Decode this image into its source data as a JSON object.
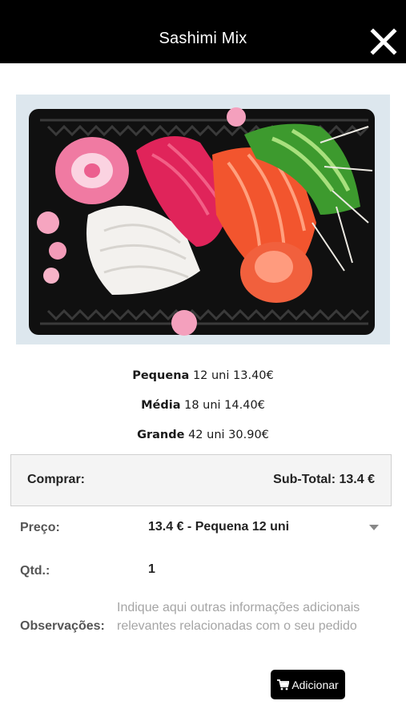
{
  "header": {
    "title": "Sashimi Mix",
    "close_icon": "close-icon"
  },
  "product_image": {
    "description_icon": "sashimi-photo"
  },
  "sizes": [
    {
      "name": "Pequena",
      "detail": "12 uni 13.40€"
    },
    {
      "name": "Média",
      "detail": "18 uni 14.40€"
    },
    {
      "name": "Grande",
      "detail": "42 uni 30.90€"
    }
  ],
  "buybar": {
    "left_label": "Comprar:",
    "subtotal": "Sub-Total: 13.4 €"
  },
  "form": {
    "price_label": "Preço:",
    "price_value": "13.4 € - Pequena 12 uni",
    "qty_label": "Qtd.:",
    "qty_value": "1",
    "obs_label": "Observações:",
    "obs_placeholder": "Indique aqui outras informações adicionais relevantes relacionadas com o seu pedido"
  },
  "add_button": {
    "label": "Adicionar",
    "icon": "cart-icon"
  },
  "colors": {
    "header_bg": "#000000",
    "button_bg": "#000000",
    "bar_bg": "#f4f4f4"
  }
}
